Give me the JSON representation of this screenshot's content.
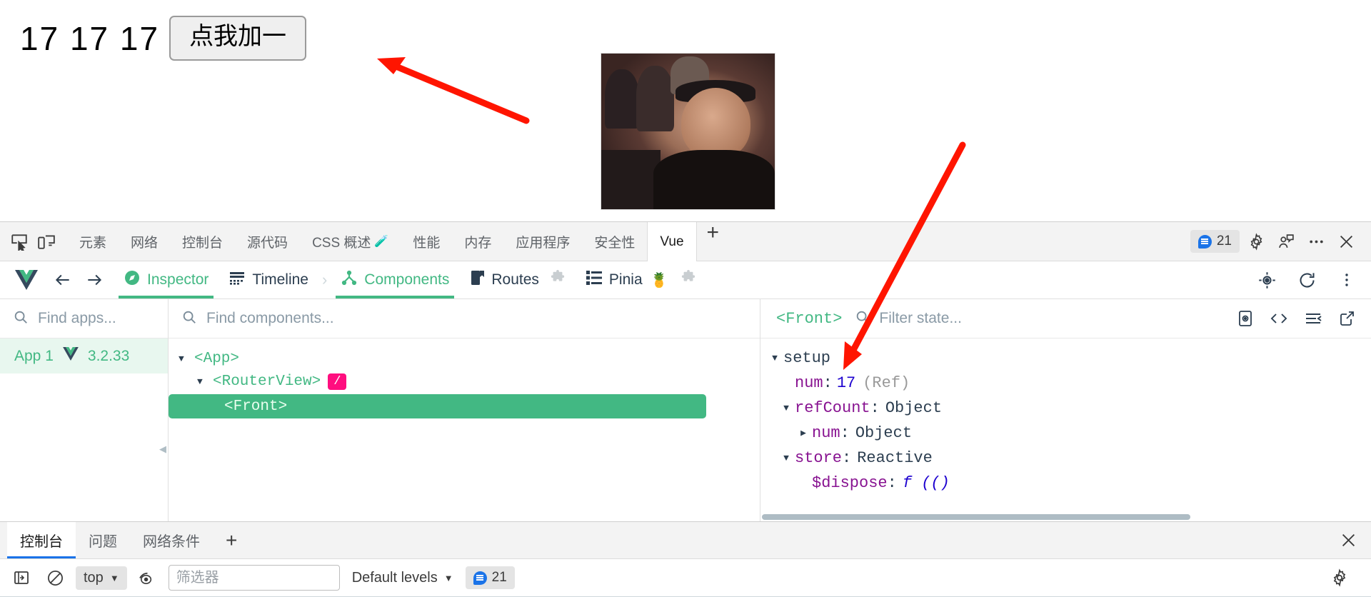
{
  "page": {
    "counter_text": "17 17 17",
    "button_label": "点我加一",
    "image_alt": "reaction-gif"
  },
  "devtools": {
    "tabs": [
      {
        "label": "元素",
        "active": false
      },
      {
        "label": "网络",
        "active": false
      },
      {
        "label": "控制台",
        "active": false
      },
      {
        "label": "源代码",
        "active": false
      },
      {
        "label": "CSS 概述",
        "active": false,
        "beta": "🧪"
      },
      {
        "label": "性能",
        "active": false
      },
      {
        "label": "内存",
        "active": false
      },
      {
        "label": "应用程序",
        "active": false
      },
      {
        "label": "安全性",
        "active": false
      },
      {
        "label": "Vue",
        "active": true
      }
    ],
    "add_tab_label": "+",
    "issues_count": "21",
    "icons": {
      "inspect": "inspect-element-icon",
      "device": "device-toolbar-icon",
      "settings": "gear-icon",
      "devices": "user-feedback-icon",
      "more": "more-options-icon",
      "close": "close-icon"
    }
  },
  "vue_toolbar": {
    "logo": "vue-logo-icon",
    "back": "back-arrow-icon",
    "forward": "forward-arrow-icon",
    "items": [
      {
        "label": "Inspector",
        "icon": "compass-icon",
        "active": true,
        "green": true
      },
      {
        "label": "Timeline",
        "icon": "timeline-icon",
        "active": false,
        "green": false
      },
      {
        "label": "Components",
        "icon": "components-icon",
        "active": true,
        "green": true
      },
      {
        "label": "Routes",
        "icon": "routes-icon",
        "active": false,
        "green": false
      },
      {
        "label": "Pinia",
        "icon": "pineapple-icon",
        "active": false,
        "green": false
      }
    ],
    "separator": "›",
    "right_icons": [
      "target-icon",
      "refresh-icon",
      "vertical-dots-icon"
    ]
  },
  "apps_panel": {
    "search_placeholder": "Find apps...",
    "search_value": "",
    "items": [
      {
        "name": "App 1",
        "version": "3.2.33",
        "selected": true
      }
    ]
  },
  "tree_panel": {
    "search_placeholder": "Find components...",
    "search_value": "",
    "nodes": [
      {
        "label": "<App>",
        "depth": 0,
        "caret": "▼",
        "selected": false,
        "badge": null
      },
      {
        "label": "<RouterView>",
        "depth": 1,
        "caret": "▼",
        "selected": false,
        "badge": "/"
      },
      {
        "label": "<Front>",
        "depth": 2,
        "caret": "",
        "selected": true,
        "badge": null
      }
    ]
  },
  "state_panel": {
    "component_name": "<Front>",
    "filter_placeholder": "Filter state...",
    "filter_value": "",
    "rows": [
      {
        "caret": "▼",
        "depth": 0,
        "key": "setup",
        "key_style": "plain",
        "colon": "",
        "value": "",
        "value_type": "",
        "note": ""
      },
      {
        "caret": "",
        "depth": 1,
        "key": "num",
        "key_style": "prop",
        "colon": ":",
        "value": "17",
        "value_type": "number",
        "note": "(Ref)"
      },
      {
        "caret": "▼",
        "depth": 1,
        "key": "refCount",
        "key_style": "prop",
        "colon": ":",
        "value": "Object",
        "value_type": "type",
        "note": ""
      },
      {
        "caret": "▶",
        "depth": 2,
        "key": "num",
        "key_style": "prop",
        "colon": ":",
        "value": "Object",
        "value_type": "type",
        "note": ""
      },
      {
        "caret": "▼",
        "depth": 1,
        "key": "store",
        "key_style": "prop",
        "colon": ":",
        "value": "Reactive",
        "value_type": "type",
        "note": ""
      },
      {
        "caret": "",
        "depth": 2,
        "key": "$dispose",
        "key_style": "prop",
        "colon": ":",
        "value": "f (()",
        "value_type": "fn",
        "note": ""
      }
    ],
    "toolbar_icons": [
      "open-in-editor-icon",
      "code-icon",
      "collapse-all-icon",
      "popout-icon"
    ]
  },
  "drawer": {
    "tabs": [
      {
        "label": "控制台",
        "active": true
      },
      {
        "label": "问题",
        "active": false
      },
      {
        "label": "网络条件",
        "active": false
      }
    ],
    "add_label": "+",
    "close_icon": "close-icon",
    "console": {
      "sidebar_icon": "console-sidebar-icon",
      "clear_icon": "clear-console-icon",
      "context": "top",
      "eye_icon": "live-expression-icon",
      "filter_placeholder": "筛选器",
      "filter_value": "",
      "levels_label": "Default levels",
      "issues_count": "21",
      "settings_icon": "gear-icon"
    }
  },
  "annotations": {
    "arrow_color": "#ff1500",
    "arrow1": "points-to-add-button",
    "arrow2": "points-to-setup-state"
  },
  "colors": {
    "vue_green": "#42b883",
    "route_pink": "#ff0e7f",
    "chrome_blue": "#1a73e8",
    "key_purple": "#881391",
    "value_blue": "#1c00cf"
  }
}
